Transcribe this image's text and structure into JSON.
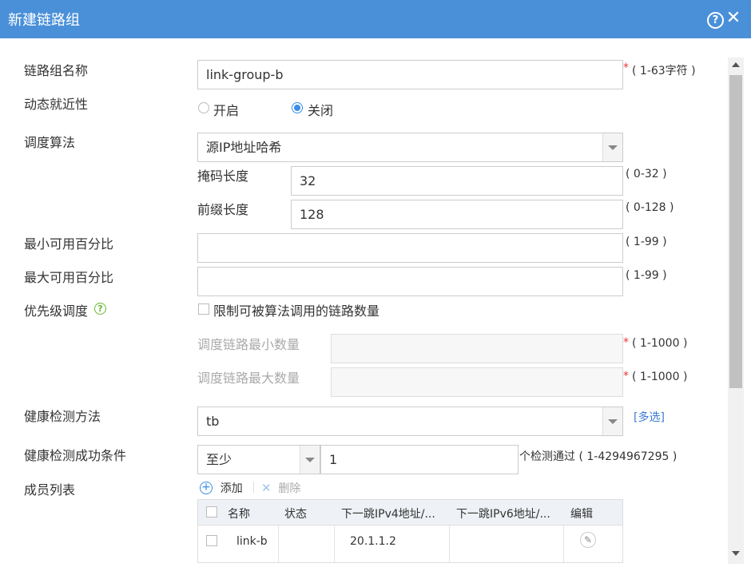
{
  "dialog": {
    "title": "新建链路组",
    "help_icon": "question-circle-icon",
    "close_icon": "close-icon"
  },
  "form": {
    "name": {
      "label": "链路组名称",
      "value": "link-group-b",
      "required": "*",
      "hint": "( 1-63字符 )"
    },
    "dynamic_proximity": {
      "label": "动态就近性",
      "options": [
        {
          "label": "开启",
          "checked": false
        },
        {
          "label": "关闭",
          "checked": true
        }
      ]
    },
    "algorithm": {
      "label": "调度算法",
      "value": "源IP地址哈希"
    },
    "mask_length": {
      "label": "掩码长度",
      "value": "32",
      "hint": "( 0-32 )"
    },
    "prefix_length": {
      "label": "前缀长度",
      "value": "128",
      "hint": "( 0-128 )"
    },
    "min_percent": {
      "label": "最小可用百分比",
      "value": "",
      "hint": "( 1-99 )"
    },
    "max_percent": {
      "label": "最大可用百分比",
      "value": "",
      "hint": "( 1-99 )"
    },
    "priority": {
      "label": "优先级调度",
      "checkbox_label": "限制可被算法调用的链路数量",
      "checked": false
    },
    "min_links": {
      "label": "调度链路最小数量",
      "required": "*",
      "hint": "( 1-1000 )"
    },
    "max_links": {
      "label": "调度链路最大数量",
      "required": "*",
      "hint": "( 1-1000 )"
    },
    "health_method": {
      "label": "健康检测方法",
      "value": "tb",
      "multi_link": "[多选]"
    },
    "health_condition": {
      "label": "健康检测成功条件",
      "select_value": "至少",
      "value": "1",
      "hint": "个检测通过 ( 1-4294967295 )"
    },
    "members": {
      "label": "成员列表",
      "add": "添加",
      "delete": "删除",
      "columns": [
        "名称",
        "状态",
        "下一跳IPv4地址/...",
        "下一跳IPv6地址/...",
        "编辑"
      ],
      "rows": [
        {
          "name": "link-b",
          "status": "",
          "ipv4": "20.1.1.2",
          "ipv6": ""
        }
      ]
    }
  },
  "colors": {
    "titlebar": "#4a90d9",
    "accent": "#3a8ee6",
    "required": "#e33333"
  }
}
